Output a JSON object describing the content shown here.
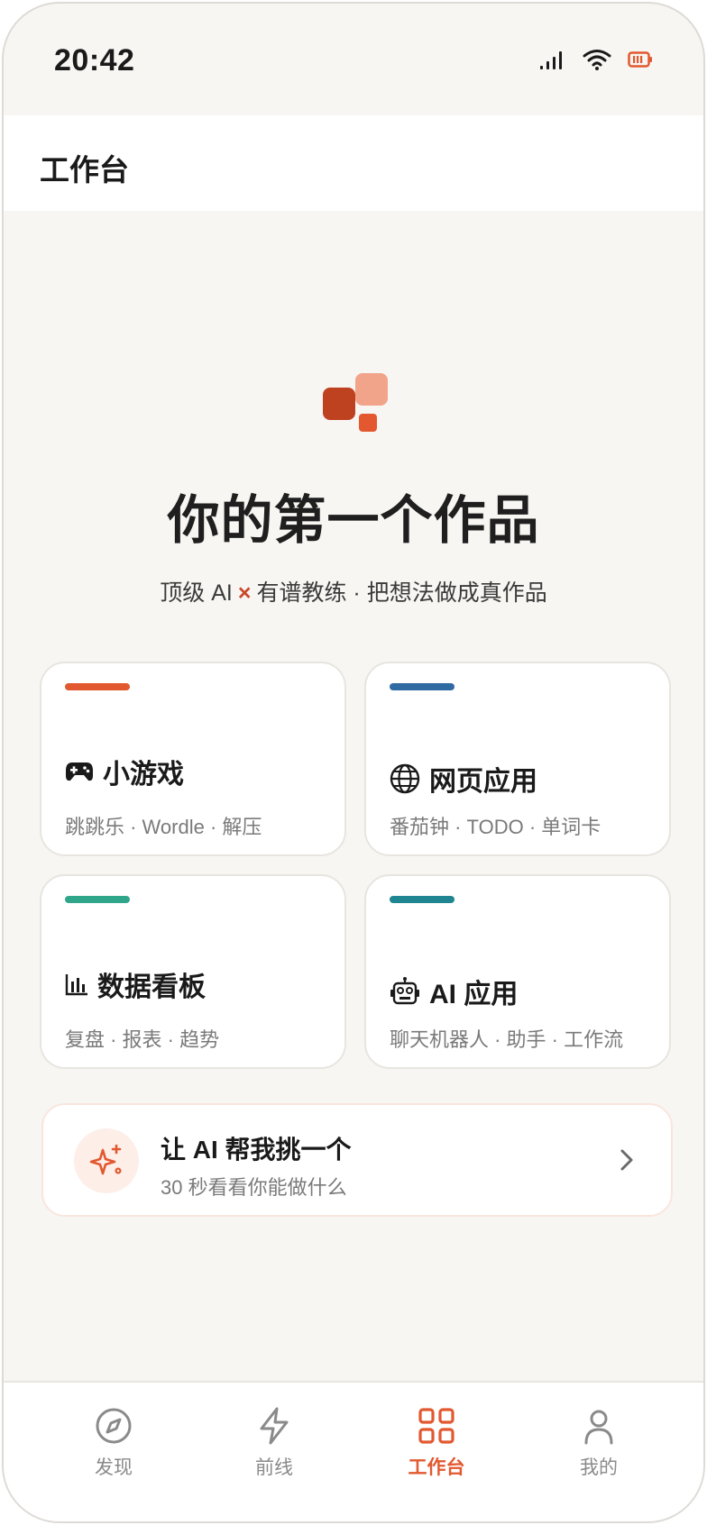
{
  "status_bar": {
    "time": "20:42",
    "icons": [
      "cellular-signal-icon",
      "wifi-icon",
      "battery-icon"
    ],
    "battery_color": "#e2582f"
  },
  "header": {
    "title": "工作台"
  },
  "hero": {
    "logo_icon": "squares-logo-icon",
    "title": "你的第一个作品",
    "subtitle_left": "顶级 AI",
    "subtitle_mark": "×",
    "subtitle_right": "有谱教练 · 把想法做成真作品"
  },
  "categories": [
    {
      "icon": "gamepad-icon",
      "title": "小游戏",
      "subtitle": "跳跳乐 · Wordle · 解压",
      "accent": "#e2582f"
    },
    {
      "icon": "globe-icon",
      "title": "网页应用",
      "subtitle": "番茄钟 · TODO · 单词卡",
      "accent": "#2f6aa3"
    },
    {
      "icon": "bar-chart-icon",
      "title": "数据看板",
      "subtitle": "复盘 · 报表 · 趋势",
      "accent": "#2fa58a"
    },
    {
      "icon": "robot-icon",
      "title": "AI 应用",
      "subtitle": "聊天机器人 · 助手 · 工作流",
      "accent": "#1f8590"
    }
  ],
  "ai_pick": {
    "icon": "sparkles-icon",
    "title": "让 AI 帮我挑一个",
    "subtitle": "30 秒看看你能做什么"
  },
  "bottom_nav": {
    "items": [
      {
        "label": "发现",
        "icon": "compass-icon"
      },
      {
        "label": "前线",
        "icon": "lightning-icon"
      },
      {
        "label": "工作台",
        "icon": "grid-icon",
        "active": true
      },
      {
        "label": "我的",
        "icon": "user-icon"
      }
    ],
    "active_color": "#e2582f",
    "inactive_color": "#8a8a8a"
  }
}
